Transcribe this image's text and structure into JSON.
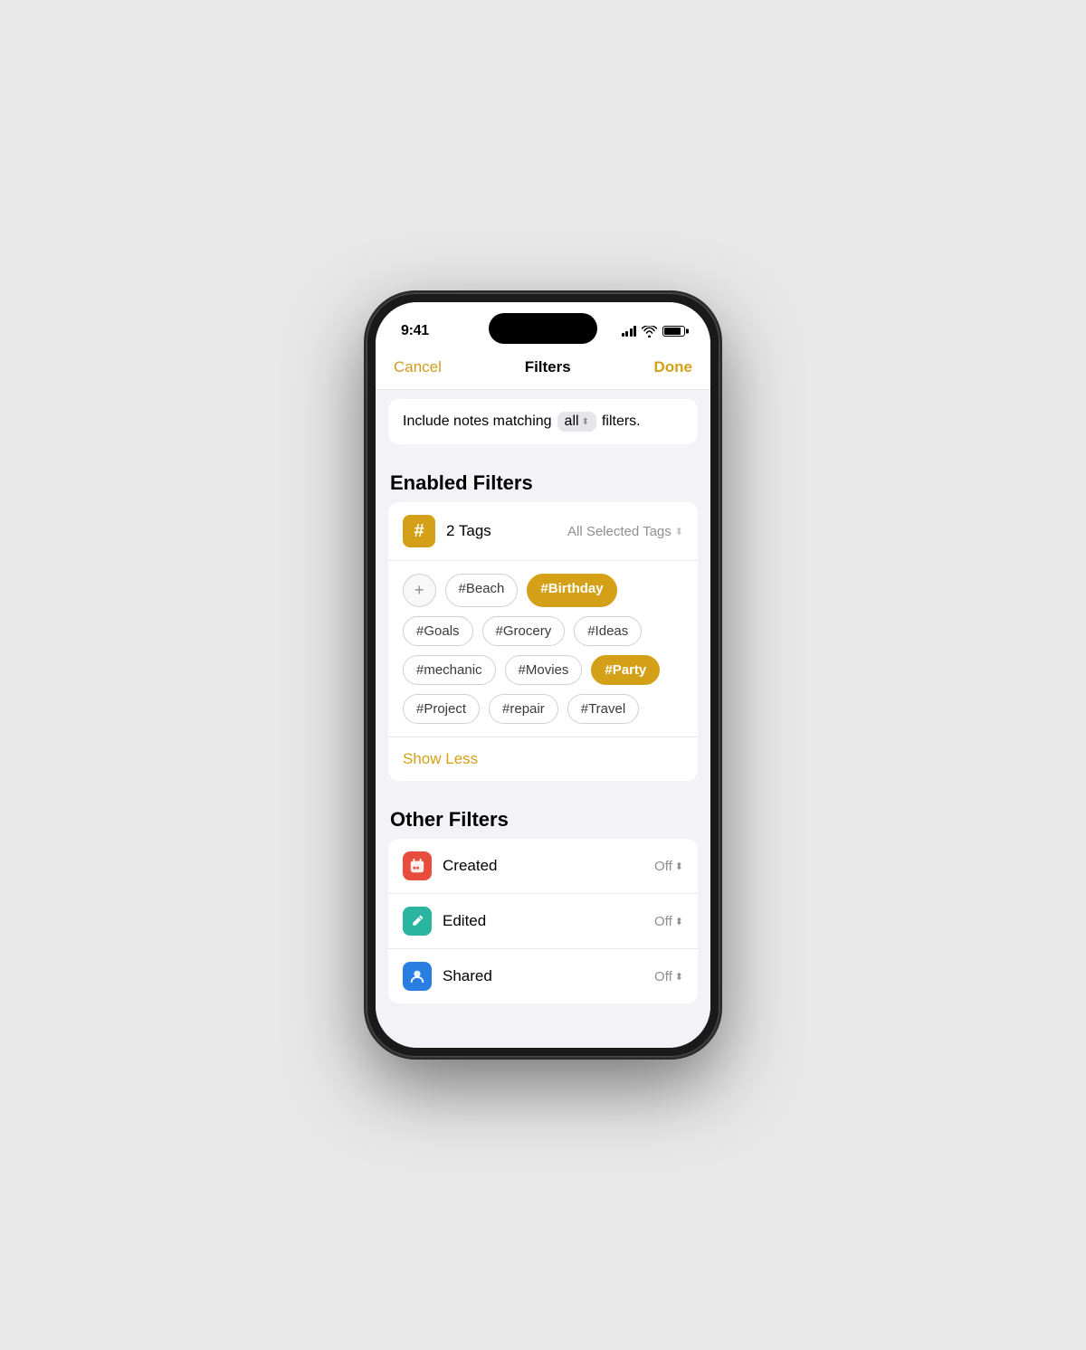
{
  "statusBar": {
    "time": "9:41"
  },
  "nav": {
    "cancel": "Cancel",
    "title": "Filters",
    "done": "Done"
  },
  "filterSentence": {
    "prefix": "Include notes matching",
    "selector": "all",
    "suffix": "filters."
  },
  "enabledFilters": {
    "sectionTitle": "Enabled Filters",
    "tagsFilter": {
      "count": "2 Tags",
      "selector": "All Selected Tags",
      "tags": [
        {
          "label": "#Beach",
          "selected": false
        },
        {
          "label": "#Birthday",
          "selected": true
        },
        {
          "label": "#Goals",
          "selected": false
        },
        {
          "label": "#Grocery",
          "selected": false
        },
        {
          "label": "#Ideas",
          "selected": false
        },
        {
          "label": "#mechanic",
          "selected": false
        },
        {
          "label": "#Movies",
          "selected": false
        },
        {
          "label": "#Party",
          "selected": true
        },
        {
          "label": "#Project",
          "selected": false
        },
        {
          "label": "#repair",
          "selected": false
        },
        {
          "label": "#Travel",
          "selected": false
        }
      ],
      "showLess": "Show Less"
    }
  },
  "otherFilters": {
    "sectionTitle": "Other Filters",
    "items": [
      {
        "label": "Created",
        "value": "Off",
        "iconColor": "red",
        "iconSymbol": "🗓"
      },
      {
        "label": "Edited",
        "value": "Off",
        "iconColor": "teal",
        "iconSymbol": "✏️"
      },
      {
        "label": "Shared",
        "value": "Off",
        "iconColor": "blue",
        "iconSymbol": "👤"
      }
    ]
  }
}
